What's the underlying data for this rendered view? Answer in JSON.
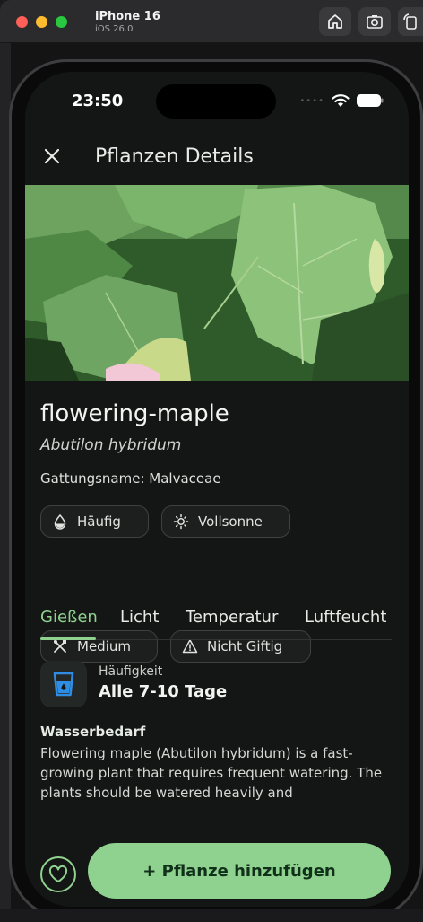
{
  "simulator": {
    "device_name": "iPhone 16",
    "os_version": "iOS 26.0",
    "buttons": [
      "home-icon",
      "screenshot-icon",
      "rotate-icon"
    ]
  },
  "status_bar": {
    "time": "23:50"
  },
  "header": {
    "title": "Pflanzen Details"
  },
  "plant": {
    "common_name": "flowering-maple",
    "latin_name": "Abutilon hybridum",
    "genus": "Gattungsname: Malvaceae"
  },
  "chips": [
    {
      "label": "Häufig",
      "icon": "water-drop-icon"
    },
    {
      "label": "Vollsonne",
      "icon": "sun-icon"
    },
    {
      "label": "Medium",
      "icon": "tools-icon"
    },
    {
      "label": "Nicht Giftig",
      "icon": "warning-icon"
    }
  ],
  "tabs": [
    {
      "label": "Gießen",
      "active": true
    },
    {
      "label": "Licht",
      "active": false
    },
    {
      "label": "Temperatur",
      "active": false
    },
    {
      "label": "Luftfeucht",
      "active": false
    }
  ],
  "watering": {
    "frequency_label": "Häufigkeit",
    "frequency_value": "Alle 7-10 Tage",
    "section_heading": "Wasserbedarf",
    "description": "Flowering maple (Abutilon hybridum) is a fast-growing plant that requires frequent watering. The plants should be watered heavily and"
  },
  "actions": {
    "add_label": "+ Pflanze hinzufügen"
  },
  "colors": {
    "accent": "#8fd18e",
    "background": "#141615",
    "chip_border": "#3c4240",
    "icon_blue": "#2f8de4"
  }
}
